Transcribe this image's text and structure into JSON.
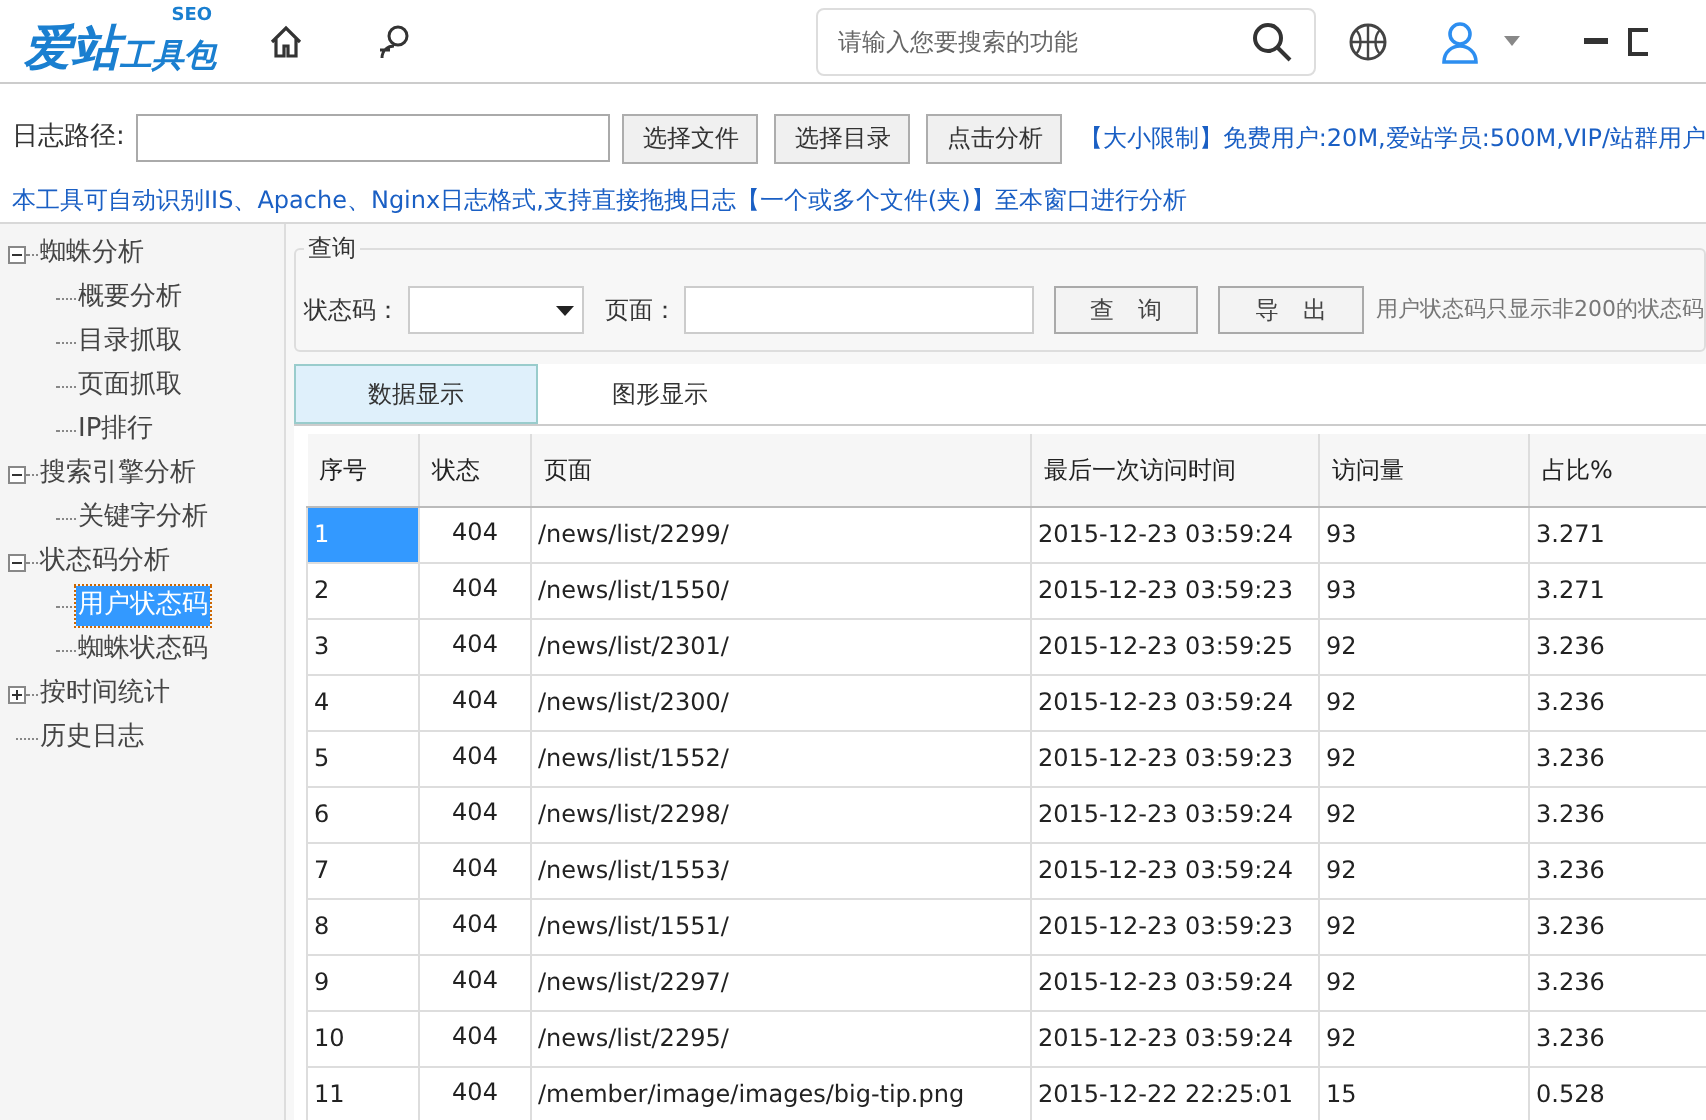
{
  "header": {
    "logo": {
      "main": "爱站",
      "sub": "工具包",
      "badge": "SEO"
    },
    "search": {
      "placeholder": "请输入您要搜索的功能"
    }
  },
  "log_path": {
    "label": "日志路径:",
    "buttons": [
      "选择文件",
      "选择目录",
      "点击分析"
    ],
    "limit_note": "【大小限制】免费用户:20M,爱站学员:500M,VIP/站群用户"
  },
  "info_line": "本工具可自动识别IIS、Apache、Nginx日志格式,支持直接拖拽日志【一个或多个文件(夹)】至本窗口进行分析",
  "sidebar": {
    "items": [
      {
        "label": "蜘蛛分析",
        "expanded": true,
        "selected": false,
        "children": [
          {
            "label": "概要分析",
            "selected": false
          },
          {
            "label": "目录抓取",
            "selected": false
          },
          {
            "label": "页面抓取",
            "selected": false
          },
          {
            "label": "IP排行",
            "selected": false
          }
        ]
      },
      {
        "label": "搜索引擎分析",
        "expanded": true,
        "selected": false,
        "children": [
          {
            "label": "关键字分析",
            "selected": false
          }
        ]
      },
      {
        "label": "状态码分析",
        "expanded": true,
        "selected": false,
        "children": [
          {
            "label": "用户状态码",
            "selected": true
          },
          {
            "label": "蜘蛛状态码",
            "selected": false
          }
        ]
      },
      {
        "label": "按时间统计",
        "expanded": false,
        "selected": false
      },
      {
        "label": "历史日志",
        "selected": false
      }
    ]
  },
  "query": {
    "title": "查询",
    "status_label": "状态码：",
    "page_label": "页面：",
    "buttons": [
      "查　询",
      "导　出"
    ],
    "note": "用户状态码只显示非200的状态码"
  },
  "tabs": [
    {
      "label": "数据显示",
      "selected": true
    },
    {
      "label": "图形显示",
      "selected": false
    }
  ],
  "table": {
    "columns": [
      "序号",
      "状态",
      "页面",
      "最后一次访问时间",
      "访问量",
      "占比%"
    ],
    "rows": [
      {
        "selected": true,
        "cells": [
          "1",
          "404",
          "/news/list/2299/",
          "2015-12-23 03:59:24",
          "93",
          "3.271"
        ]
      },
      {
        "selected": false,
        "cells": [
          "2",
          "404",
          "/news/list/1550/",
          "2015-12-23 03:59:23",
          "93",
          "3.271"
        ]
      },
      {
        "selected": false,
        "cells": [
          "3",
          "404",
          "/news/list/2301/",
          "2015-12-23 03:59:25",
          "92",
          "3.236"
        ]
      },
      {
        "selected": false,
        "cells": [
          "4",
          "404",
          "/news/list/2300/",
          "2015-12-23 03:59:24",
          "92",
          "3.236"
        ]
      },
      {
        "selected": false,
        "cells": [
          "5",
          "404",
          "/news/list/1552/",
          "2015-12-23 03:59:23",
          "92",
          "3.236"
        ]
      },
      {
        "selected": false,
        "cells": [
          "6",
          "404",
          "/news/list/2298/",
          "2015-12-23 03:59:24",
          "92",
          "3.236"
        ]
      },
      {
        "selected": false,
        "cells": [
          "7",
          "404",
          "/news/list/1553/",
          "2015-12-23 03:59:24",
          "92",
          "3.236"
        ]
      },
      {
        "selected": false,
        "cells": [
          "8",
          "404",
          "/news/list/1551/",
          "2015-12-23 03:59:23",
          "92",
          "3.236"
        ]
      },
      {
        "selected": false,
        "cells": [
          "9",
          "404",
          "/news/list/2297/",
          "2015-12-23 03:59:24",
          "92",
          "3.236"
        ]
      },
      {
        "selected": false,
        "cells": [
          "10",
          "404",
          "/news/list/2295/",
          "2015-12-23 03:59:24",
          "92",
          "3.236"
        ]
      },
      {
        "selected": false,
        "cells": [
          "11",
          "404",
          "/member/image/images/big-tip.png",
          "2015-12-22 22:25:01",
          "15",
          "0.528"
        ]
      }
    ]
  }
}
